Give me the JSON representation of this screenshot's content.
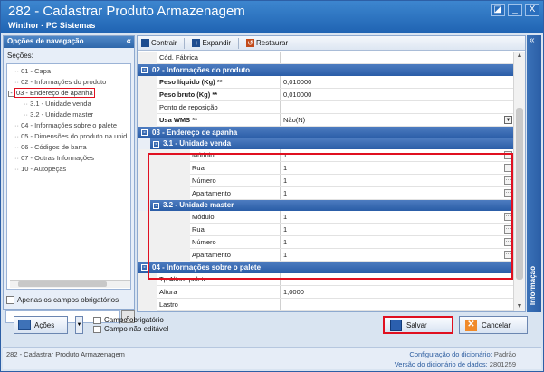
{
  "window": {
    "title": "282 - Cadastrar Produto Armazenagem",
    "subtitle": "Winthor - PC Sistemas",
    "controls": [
      "◪",
      "_",
      "X"
    ]
  },
  "nav": {
    "header": "Opções de navegação",
    "collapse": "«",
    "secoes_label": "Seções:",
    "items": [
      {
        "label": "01 - Capa"
      },
      {
        "label": "02 - Informações do produto"
      },
      {
        "label": "03 - Endereço de apanha"
      },
      {
        "label": "3.1 - Unidade venda"
      },
      {
        "label": "3.2 - Unidade master"
      },
      {
        "label": "04 - Informações sobre o palete"
      },
      {
        "label": "05 - Dimensões do produto na unid"
      },
      {
        "label": "06 - Códigos de barra"
      },
      {
        "label": "07 - Outras Informações"
      },
      {
        "label": "10 - Autopeças"
      }
    ],
    "only_required_label": "Apenas os campos obrigatórios"
  },
  "toolbar": {
    "contrair": "Contrair",
    "expandir": "Expandir",
    "restaurar": "Restaurar"
  },
  "grid": {
    "top_row": {
      "label": "Cód. Fábrica",
      "value": ""
    },
    "section02": {
      "title": "02 - Informações do produto",
      "rows": [
        {
          "label": "Peso líquido (Kg) **",
          "value": "0,010000"
        },
        {
          "label": "Peso bruto (Kg) **",
          "value": "0,010000"
        },
        {
          "label": "Ponto de reposição",
          "value": ""
        },
        {
          "label": "Usa WMS **",
          "value": "Não(N)"
        }
      ]
    },
    "section03": {
      "title": "03 - Endereço de apanha",
      "sub1": {
        "title": "3.1 - Unidade venda",
        "rows": [
          {
            "label": "Módulo",
            "value": "1"
          },
          {
            "label": "Rua",
            "value": "1"
          },
          {
            "label": "Número",
            "value": "1"
          },
          {
            "label": "Apartamento",
            "value": "1"
          }
        ]
      },
      "sub2": {
        "title": "3.2 - Unidade master",
        "rows": [
          {
            "label": "Módulo",
            "value": "1"
          },
          {
            "label": "Rua",
            "value": "1"
          },
          {
            "label": "Número",
            "value": "1"
          },
          {
            "label": "Apartamento",
            "value": "1"
          }
        ]
      }
    },
    "section04": {
      "title": "04 - Informações sobre o palete",
      "rows": [
        {
          "label": "Tp.Altura palete",
          "value": ""
        },
        {
          "label": "Altura",
          "value": "1,0000"
        },
        {
          "label": "Lastro",
          "value": ""
        }
      ]
    }
  },
  "rightbar": {
    "label": "Informação",
    "collapse": "«"
  },
  "bottom": {
    "acoes": "Ações",
    "legend_required": "Campo obrigatório",
    "legend_readonly": "Campo não editável",
    "salvar": "Salvar",
    "cancelar": "Cancelar"
  },
  "status": {
    "left": "282 - Cadastrar Produto Armazenagem",
    "config_label": "Configuração do dicionário:",
    "config_value": "Padrão",
    "version_label": "Versão do dicionário de dados:",
    "version_value": "2801259"
  },
  "colors": {
    "accent": "#2a5da7",
    "highlight": "#e01020"
  }
}
